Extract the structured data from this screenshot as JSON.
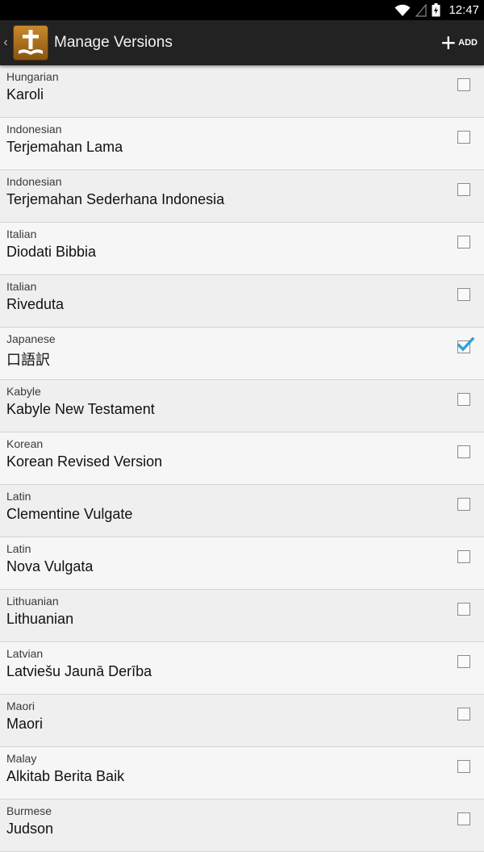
{
  "status": {
    "time": "12:47"
  },
  "actionbar": {
    "title": "Manage Versions",
    "add_label": "ADD"
  },
  "versions": [
    {
      "language": "Hungarian",
      "name": "Karoli",
      "checked": false
    },
    {
      "language": "Indonesian",
      "name": "Terjemahan Lama",
      "checked": false
    },
    {
      "language": "Indonesian",
      "name": "Terjemahan Sederhana Indonesia",
      "checked": false
    },
    {
      "language": "Italian",
      "name": "Diodati Bibbia",
      "checked": false
    },
    {
      "language": "Italian",
      "name": "Riveduta",
      "checked": false
    },
    {
      "language": "Japanese",
      "name": "口語訳",
      "checked": true
    },
    {
      "language": "Kabyle",
      "name": "Kabyle New Testament",
      "checked": false
    },
    {
      "language": "Korean",
      "name": "Korean Revised Version",
      "checked": false
    },
    {
      "language": "Latin",
      "name": "Clementine Vulgate",
      "checked": false
    },
    {
      "language": "Latin",
      "name": "Nova Vulgata",
      "checked": false
    },
    {
      "language": "Lithuanian",
      "name": "Lithuanian",
      "checked": false
    },
    {
      "language": "Latvian",
      "name": "Latviešu Jaunā Derība",
      "checked": false
    },
    {
      "language": "Maori",
      "name": "Maori",
      "checked": false
    },
    {
      "language": "Malay",
      "name": "Alkitab Berita Baik",
      "checked": false
    },
    {
      "language": "Burmese",
      "name": "Judson",
      "checked": false
    }
  ],
  "colors": {
    "accent": "#33a1d6",
    "actionbar": "#222222"
  }
}
